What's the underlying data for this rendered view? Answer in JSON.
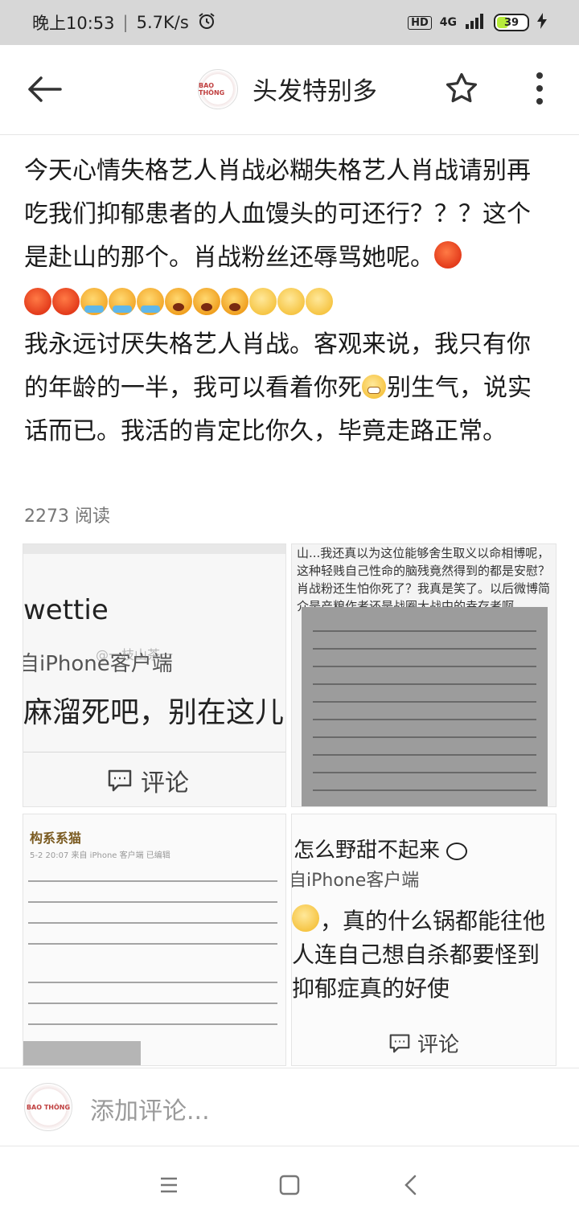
{
  "status_bar": {
    "time": "晚上10:53",
    "speed": "5.7K/s",
    "hd": "HD",
    "network": "4G",
    "battery": "39"
  },
  "header": {
    "title": "头发特别多",
    "avatar_text": "BAO THÔNG"
  },
  "post": {
    "line1": "今天心情失格艺人肖战必糊失格艺人肖战请别再吃我们抑郁患者的人血馒头的可还行？？？这个是赴山的那个。肖战粉丝还辱骂她呢。",
    "emoji_row": [
      "angry",
      "angry",
      "angry",
      "cry",
      "cry",
      "cry",
      "yell",
      "yell",
      "yell",
      "smirk",
      "smirk",
      "smirk"
    ],
    "line2a": "我永远讨厌失格艺人肖战。客观来说，我只有你的年龄的一半，我可以看着你死",
    "line2b": "别生气，说实话而已。我活的肯定比你久，毕竟走路正常。",
    "reads": "2273 阅读"
  },
  "images": {
    "tile1": {
      "name": "wettie",
      "client": "自iPhone客户端",
      "quote": "麻溜死吧，别在这儿",
      "watermark": "@一枝山茶一",
      "comment": "评论"
    },
    "tile2": {
      "text": "山...我还真以为这位能够舍生取义以命相博呢，这种轻贱自己性命的脑残竟然得到的都是安慰？肖战粉还生怕你死了？我真是笑了。以后微博简介是产粮作者还是战圈大战中的幸存者啊。"
    },
    "tile3": {
      "header": "构系系猫",
      "meta": "5-2 20:07  来自 iPhone 客户端  已编辑"
    },
    "tile4": {
      "title": "怎么野甜不起来",
      "client": "自iPhone客户端",
      "body_line1": "，真的什么锅都能往他",
      "body_line2": "人连自己想自杀都要怪到",
      "body_line3": "抑郁症真的好使",
      "comment": "评论"
    }
  },
  "comment_bar": {
    "placeholder": "添加评论..."
  },
  "colors": {
    "status_bg": "#d7d7d7",
    "text": "#1a1a1a",
    "muted": "#777777",
    "battery_fill": "#b7ec3a"
  },
  "icons": [
    "back-arrow-icon",
    "star-icon",
    "more-vert-icon",
    "comment-icon",
    "menu-icon",
    "home-square-icon",
    "back-chevron-icon"
  ]
}
